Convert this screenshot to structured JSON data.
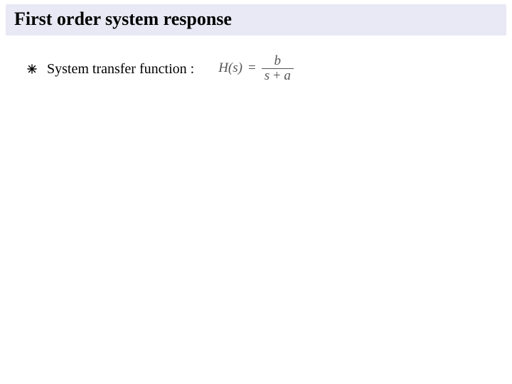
{
  "title": "First order system response",
  "bullet": {
    "text": "System transfer function :"
  },
  "formula": {
    "lhs_func": "H",
    "lhs_arg": "s",
    "numerator": "b",
    "denominator_left": "s",
    "denominator_op": "+",
    "denominator_right": "a"
  }
}
